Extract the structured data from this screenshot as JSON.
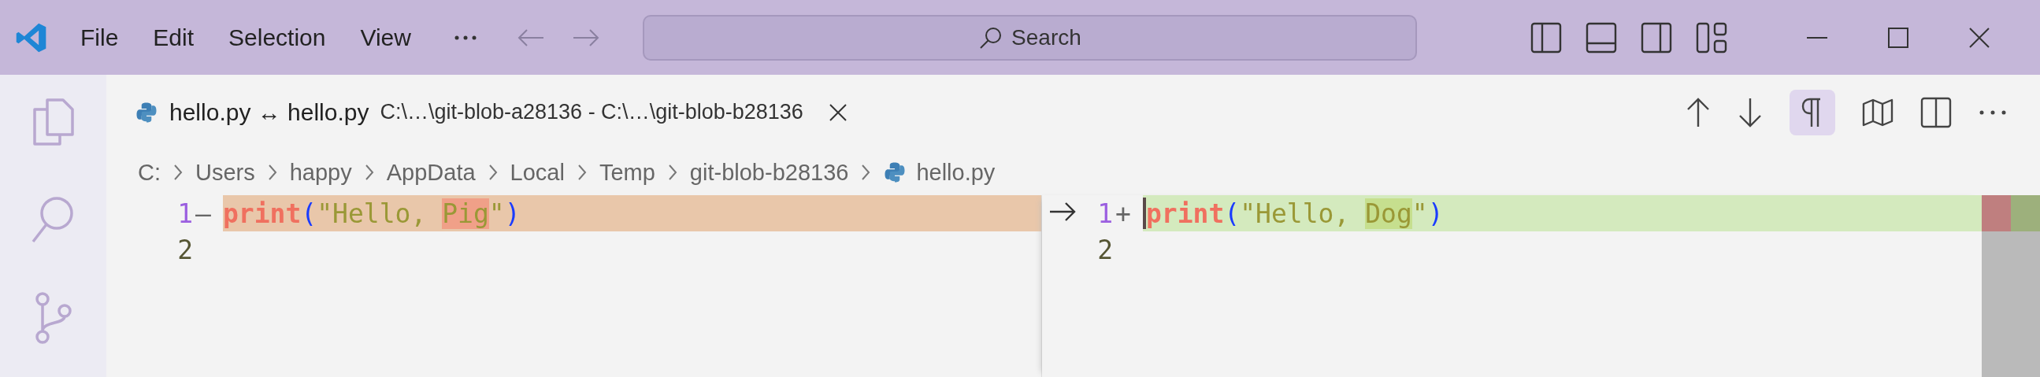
{
  "title_bar": {
    "menu": [
      "File",
      "Edit",
      "Selection",
      "View"
    ],
    "search": {
      "label": "Search"
    }
  },
  "tab": {
    "title": "hello.py ↔ hello.py",
    "description": "C:\\…\\git-blob-a28136 - C:\\…\\git-blob-b28136"
  },
  "editor_actions": {
    "render_whitespace": {
      "selected": true
    }
  },
  "breadcrumb": [
    {
      "label": "C:",
      "kind": "folder"
    },
    {
      "label": "Users",
      "kind": "folder"
    },
    {
      "label": "happy",
      "kind": "folder"
    },
    {
      "label": "AppData",
      "kind": "folder"
    },
    {
      "label": "Local",
      "kind": "folder"
    },
    {
      "label": "Temp",
      "kind": "folder"
    },
    {
      "label": "git-blob-b28136",
      "kind": "folder"
    },
    {
      "label": "hello.py",
      "kind": "file"
    }
  ],
  "diff": {
    "left": {
      "lines": [
        {
          "number": "1",
          "active": true,
          "kind": "removed",
          "marker": "—",
          "cursor": false,
          "tokens": [
            {
              "text": "print",
              "kind": "function",
              "changed": false
            },
            {
              "text": "(",
              "kind": "paren",
              "changed": false
            },
            {
              "text": "\"Hello, ",
              "kind": "string",
              "changed": false
            },
            {
              "text": "Pig",
              "kind": "string",
              "changed": true
            },
            {
              "text": "\"",
              "kind": "string",
              "changed": false
            },
            {
              "text": ")",
              "kind": "paren",
              "changed": false
            }
          ]
        },
        {
          "number": "2",
          "active": false,
          "kind": "plain",
          "cursor": false
        }
      ]
    },
    "right": {
      "lines": [
        {
          "number": "1",
          "active": true,
          "kind": "added",
          "marker": "+",
          "cursor": true,
          "tokens": [
            {
              "text": "print",
              "kind": "function",
              "changed": false
            },
            {
              "text": "(",
              "kind": "paren",
              "changed": false
            },
            {
              "text": "\"Hello, ",
              "kind": "string",
              "changed": false
            },
            {
              "text": "Dog",
              "kind": "string",
              "changed": true
            },
            {
              "text": "\"",
              "kind": "string",
              "changed": false
            },
            {
              "text": ")",
              "kind": "paren",
              "changed": false
            }
          ]
        },
        {
          "number": "2",
          "active": false,
          "kind": "plain",
          "cursor": false
        }
      ]
    }
  }
}
